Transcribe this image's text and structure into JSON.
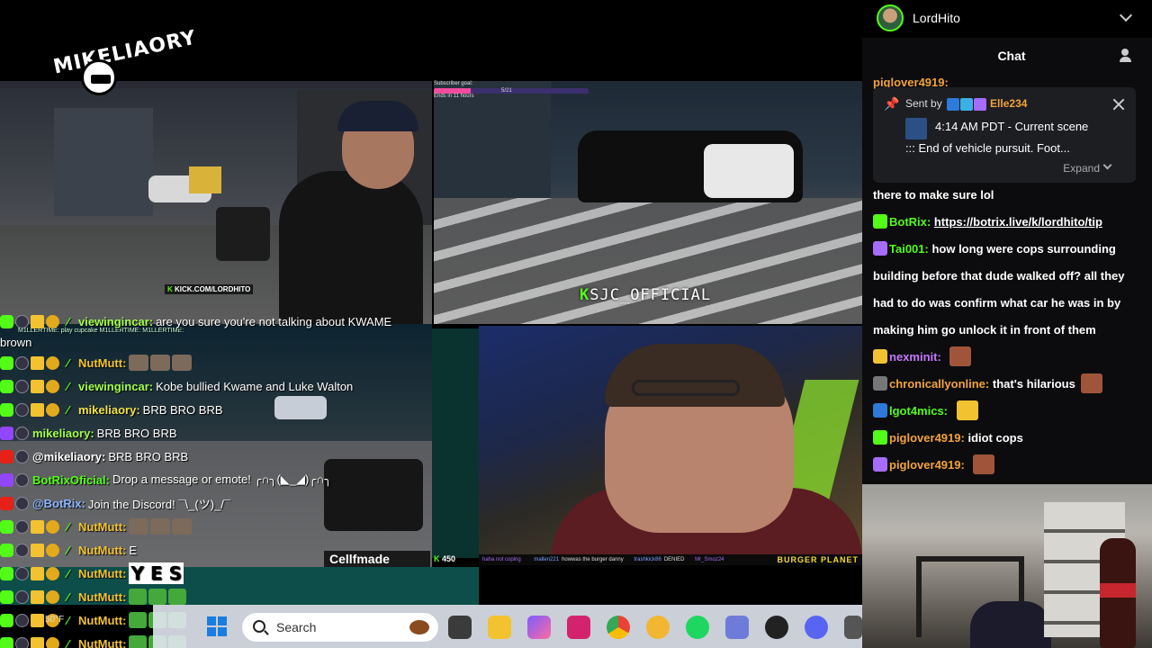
{
  "stream": {
    "logo_text": "MIKELIAORY",
    "feed_a_watermark": "KICK.COM/LORDHITO",
    "feed_a_mini_chat": "M1LLERTIME: play cupcake   M1LLERTIME:   M1LLERTIME:",
    "sub_goal_label": "Subscriber goal:",
    "sub_goal_count": "5/21",
    "sub_goal_ends": "Ends in 11 hours",
    "sub_goal_progress": 0.24,
    "feed_b_watermark": "SJC_OFFICIAL",
    "cellf_label": "Cellfmade",
    "viewer_count": "450",
    "bottom_ticker": [
      {
        "user": "haha not coping",
        "msg": ""
      },
      {
        "user": "mallen221",
        "msg": "howwas the burger danny"
      },
      {
        "user": "trashkick86",
        "msg": "DENIED"
      },
      {
        "user": "Mr_Smoz24",
        "msg": ""
      }
    ],
    "burger_text": "BURGER PLANET",
    "weather": "50°F"
  },
  "overlay_chat": [
    {
      "platform": "kick",
      "user": "viewingincar",
      "user_color": "#a0ff4a",
      "msg": "are you sure you're not talking about KWAME",
      "cont": "brown"
    },
    {
      "platform": "kick",
      "user": "NutMutt",
      "user_color": "#f2c230",
      "msg": ""
    },
    {
      "platform": "kick",
      "user": "viewingincar",
      "user_color": "#a0ff4a",
      "msg": "Kobe bullied Kwame and Luke Walton"
    },
    {
      "platform": "kick",
      "user": "mikeliaory",
      "user_color": "#f2e24a",
      "msg": "BRB BRO BRB"
    },
    {
      "platform": "twitch",
      "user": "mikeliaory",
      "user_color": "#a0ff4a",
      "msg": "BRB BRO BRB"
    },
    {
      "platform": "youtube",
      "user": "@mikeliaory",
      "user_color": "#ffffff",
      "msg": "BRB BRO BRB"
    },
    {
      "platform": "twitch",
      "user": "BotRixOficial",
      "user_color": "#53fc18",
      "msg": "Drop a message or emote! ╭∩╮(◣_◢)╭∩╮"
    },
    {
      "platform": "youtube",
      "user": "@BotRix",
      "user_color": "#8ab4ff",
      "msg": "Join the Discord! ¯\\_(ツ)_/¯"
    },
    {
      "platform": "kick",
      "user": "NutMutt",
      "user_color": "#f2c230",
      "msg": ""
    },
    {
      "platform": "kick",
      "user": "NutMutt",
      "user_color": "#f2c230",
      "msg": "E"
    },
    {
      "platform": "kick",
      "user": "NutMutt",
      "user_color": "#f2c230",
      "msg": "Y E S"
    },
    {
      "platform": "kick",
      "user": "NutMutt",
      "user_color": "#f2c230",
      "msg": ""
    },
    {
      "platform": "kick",
      "user": "NutMutt",
      "user_color": "#f2c230",
      "msg": ""
    },
    {
      "platform": "kick",
      "user": "NutMutt",
      "user_color": "#f2c230",
      "msg": ""
    }
  ],
  "taskbar": {
    "search_placeholder": "Search"
  },
  "chat_panel": {
    "channel_name": "LordHito",
    "title": "Chat",
    "peek_user": "piglover4919:",
    "pinned": {
      "sent_by_label": "Sent by",
      "sender": "Elle234",
      "line1": "4:14 AM PDT - Current scene",
      "line2": "::: End of vehicle pursuit. Foot...",
      "expand_label": "Expand"
    },
    "messages": [
      {
        "user": "",
        "color": "#ffffff",
        "text": "there to make sure lol"
      },
      {
        "user": "BotRix:",
        "color": "#53fc18",
        "text": "https://botrix.live/k/lordhito/tip",
        "link": true
      },
      {
        "user": "Tai001:",
        "color": "#53fc18",
        "text": "how long were cops surrounding building before that dude walked off? all they had to do was confirm what car he was in by making him go unlock it in front of them"
      },
      {
        "user": "nexminit:",
        "color": "#c678ff",
        "text": ""
      },
      {
        "user": "chronicallyonline:",
        "color": "#f2a33a",
        "text": "that's hilarious"
      },
      {
        "user": "lgot4mics:",
        "color": "#53fc18",
        "text": ""
      },
      {
        "user": "piglover4919:",
        "color": "#f2a33a",
        "text": "idiot cops"
      },
      {
        "user": "piglover4919:",
        "color": "#f2a33a",
        "text": ""
      }
    ]
  }
}
